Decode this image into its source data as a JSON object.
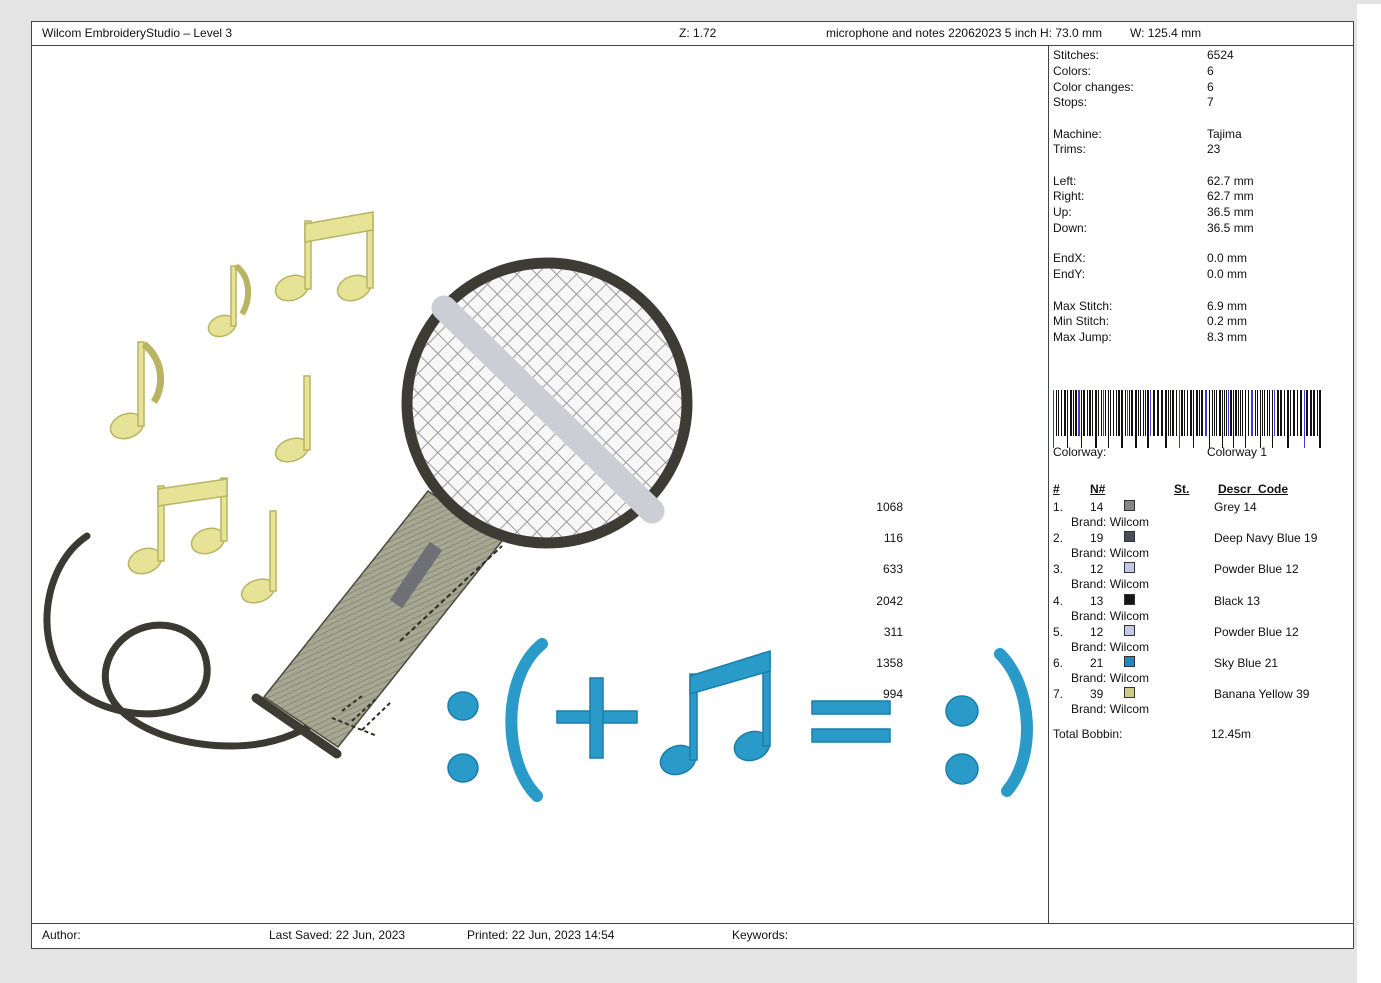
{
  "header": {
    "app_title": "Wilcom EmbroideryStudio – Level 3",
    "zoom": "Z: 1.72",
    "design_name": "microphone and notes 22062023 5 inch",
    "height": "H: 73.0 mm",
    "width": "W: 125.4 mm"
  },
  "stats": [
    {
      "k": "Stitches:",
      "v": "6524"
    },
    {
      "k": "Colors:",
      "v": "6"
    },
    {
      "k": "Color changes:",
      "v": "6"
    },
    {
      "k": "Stops:",
      "v": "7"
    },
    {
      "k": "Machine:",
      "v": "Tajima"
    },
    {
      "k": "Trims:",
      "v": "23"
    },
    {
      "k": "Left:",
      "v": "62.7 mm"
    },
    {
      "k": "Right:",
      "v": "62.7 mm"
    },
    {
      "k": "Up:",
      "v": "36.5 mm"
    },
    {
      "k": "Down:",
      "v": "36.5 mm"
    },
    {
      "k": "EndX:",
      "v": "0.0 mm"
    },
    {
      "k": "EndY:",
      "v": "0.0 mm"
    },
    {
      "k": "Max Stitch:",
      "v": "6.9 mm"
    },
    {
      "k": "Min Stitch:",
      "v": "0.2 mm"
    },
    {
      "k": "Max Jump:",
      "v": "8.3 mm"
    }
  ],
  "colorway": {
    "label": "Colorway:",
    "value": "Colorway 1"
  },
  "color_table": {
    "headers": {
      "num": "#",
      "code": "N#",
      "stitches": "St.",
      "descr": "Descr_Code"
    },
    "rows": [
      {
        "idx": "1.",
        "code": "14",
        "stitches": "1068",
        "descr": "Grey 14",
        "brand": "Brand: Wilcom",
        "color": "#858585"
      },
      {
        "idx": "2.",
        "code": "19",
        "stitches": "116",
        "descr": "Deep Navy Blue 19",
        "brand": "Brand: Wilcom",
        "color": "#4a4c5c"
      },
      {
        "idx": "3.",
        "code": "12",
        "stitches": "633",
        "descr": "Powder Blue 12",
        "brand": "Brand: Wilcom",
        "color": "#c4c8e2"
      },
      {
        "idx": "4.",
        "code": "13",
        "stitches": "2042",
        "descr": "Black 13",
        "brand": "Brand: Wilcom",
        "color": "#161616"
      },
      {
        "idx": "5.",
        "code": "12",
        "stitches": "311",
        "descr": "Powder Blue 12",
        "brand": "Brand: Wilcom",
        "color": "#c4c8e2"
      },
      {
        "idx": "6.",
        "code": "21",
        "stitches": "1358",
        "descr": "Sky Blue 21",
        "brand": "Brand: Wilcom",
        "color": "#1e88c6"
      },
      {
        "idx": "7.",
        "code": "39",
        "stitches": "994",
        "descr": "Banana Yellow 39",
        "brand": "Brand: Wilcom",
        "color": "#cfc98a"
      }
    ],
    "total_bobbin_label": "Total Bobbin:",
    "total_bobbin_value": "12.45m"
  },
  "footer": {
    "author": "Author:",
    "last_saved": "Last Saved: 22 Jun, 2023",
    "printed": "Printed: 22 Jun, 2023 14:54",
    "keywords": "Keywords:"
  },
  "design_colors": {
    "note_yellow": "#e6e296",
    "note_outline": "#b8b462",
    "cable": "#3a3a32",
    "handle": "#9c9e8c",
    "grille": "#f4f4f4",
    "ring": "#3c3c34",
    "bar": "#d8dae0",
    "slot": "#6e7076",
    "sky_blue": "#2a9bc9"
  }
}
